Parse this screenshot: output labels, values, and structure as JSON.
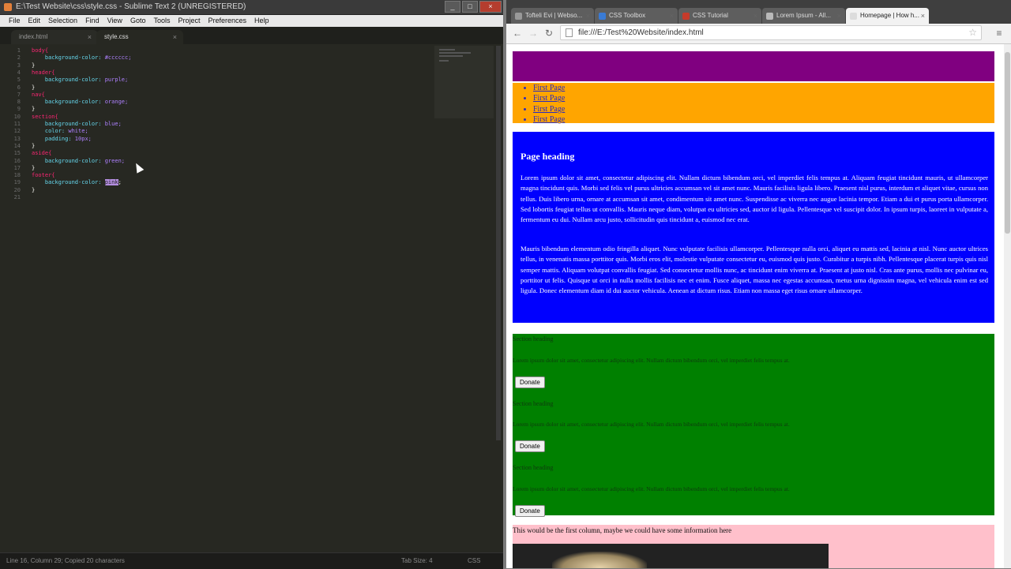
{
  "sublime": {
    "title": "E:\\Test Website\\css\\style.css - Sublime Text 2 (UNREGISTERED)",
    "menu": [
      "File",
      "Edit",
      "Selection",
      "Find",
      "View",
      "Goto",
      "Tools",
      "Project",
      "Preferences",
      "Help"
    ],
    "tabs": [
      {
        "label": "index.html",
        "close": "×"
      },
      {
        "label": "style.css",
        "close": "×"
      }
    ],
    "line_numbers": [
      "1",
      "2",
      "3",
      "4",
      "5",
      "6",
      "7",
      "8",
      "9",
      "10",
      "11",
      "12",
      "13",
      "14",
      "15",
      "16",
      "17",
      "18",
      "19",
      "20",
      "21"
    ],
    "code": [
      {
        "sel": "body{"
      },
      {
        "prop": "    background-color: ",
        "val": "#cccccc;"
      },
      {
        "pun": "}"
      },
      {
        "sel": "header{"
      },
      {
        "prop": "    background-color: ",
        "val": "purple;"
      },
      {
        "pun": "}"
      },
      {
        "sel": "nav{"
      },
      {
        "prop": "    background-color: ",
        "val": "orange;"
      },
      {
        "pun": "}"
      },
      {
        "sel": "section{"
      },
      {
        "prop": "    background-color: ",
        "val": "blue;"
      },
      {
        "prop": "    color: ",
        "val": "white;"
      },
      {
        "prop": "    padding: ",
        "val": "10px;"
      },
      {
        "pun": "}"
      },
      {
        "sel": "aside{"
      },
      {
        "prop": "    background-color: ",
        "val": "green;"
      },
      {
        "pun": "}"
      },
      {
        "sel": "footer{"
      },
      {
        "prop": "    background-color: ",
        "val": "pink",
        "hl": true,
        "tail": ";"
      },
      {
        "pun": "}"
      }
    ],
    "status": {
      "left": "Line 16, Column 29; Copied 20 characters",
      "middle": "Tab Size: 4",
      "right": "CSS"
    },
    "window_buttons": [
      "_",
      "□",
      "×"
    ]
  },
  "chrome": {
    "tabs": [
      {
        "label": "Tofteli Evi | Webso...",
        "close": "×"
      },
      {
        "label": "CSS Toolbox",
        "close": "×"
      },
      {
        "label": "CSS Tutorial",
        "close": "×"
      },
      {
        "label": "Lorem Ipsum - All...",
        "close": "×"
      },
      {
        "label": "Homepage | How h...",
        "close": "×"
      }
    ],
    "url": "file:///E:/Test%20Website/index.html",
    "nav": {
      "back": "←",
      "forward": "→",
      "reload": "↻",
      "star": "☆",
      "menu": "≡"
    }
  },
  "webpage": {
    "header_title": "",
    "nav_items": [
      "First Page",
      "First Page",
      "First Page",
      "First Page"
    ],
    "main": {
      "heading": "Page heading",
      "para1": "Lorem ipsum dolor sit amet, consectetur adipiscing elit. Nullam dictum bibendum orci, vel imperdiet felis tempus at. Aliquam feugiat tincidunt mauris, ut ullamcorper magna tincidunt quis. Morbi sed felis vel purus ultricies accumsan vel sit amet nunc. Mauris facilisis ligula libero. Praesent nisl purus, interdum et aliquet vitae, cursus non tellus. Duis libero urna, ornare at accumsan sit amet, condimentum sit amet nunc. Suspendisse ac viverra nec augue lacinia tempor. Etiam a dui et purus porta ullamcorper. Sed lobortis feugiat tellus ut convallis. Mauris neque diam, volutpat eu ultricies sed, auctor id ligula. Pellentesque vel suscipit dolor. In ipsum turpis, laoreet in vulputate a, fermentum eu dui. Nullam arcu justo, sollicitudin quis tincidunt a, euismod nec erat.",
      "para2": "Mauris bibendum elementum odio fringilla aliquet. Nunc vulputate facilisis ullamcorper. Pellentesque nulla orci, aliquet eu mattis sed, lacinia at nisl. Nunc auctor ultrices tellus, in venenatis massa porttitor quis. Morbi eros elit, molestie vulputate consectetur eu, euismod quis justo. Curabitur a turpis nibh. Pellentesque placerat turpis quis nisl semper mattis. Aliquam volutpat convallis feugiat. Sed consectetur mollis nunc, ac tincidunt enim viverra at. Praesent at justo nisl. Cras ante purus, mollis nec pulvinar eu, porttitor ut felis. Quisque ut orci in nulla mollis facilisis nec et enim. Fusce aliquet, massa nec egestas accumsan, metus urna dignissim magna, vel vehicula enim est sed ligula. Donec elementum diam id dui auctor vehicula. Aenean at dictum risus. Etiam non massa eget risus ornare ullamcorper."
    },
    "aside": [
      {
        "heading": "Section heading",
        "text": "Lorem ipsum dolor sit amet, consectetur adipiscing elit. Nullam dictum bibendum orci, vel imperdiet felis tempus at.",
        "button": "Donate"
      },
      {
        "heading": "Section heading",
        "text": "Lorem ipsum dolor sit amet, consectetur adipiscing elit. Nullam dictum bibendum orci, vel imperdiet felis tempus at.",
        "button": "Donate"
      },
      {
        "heading": "Section heading",
        "text": "Lorem ipsum dolor sit amet, consectetur adipiscing elit. Nullam dictum bibendum orci, vel imperdiet felis tempus at.",
        "button": "Donate"
      }
    ],
    "footer_text": "This would be the first column, maybe we could have some information here"
  },
  "colors": {
    "header": "#800080",
    "nav": "#ffa500",
    "main": "#0000ff",
    "aside": "#008000",
    "footer": "#ffc0cb",
    "editor_bg": "#272822"
  }
}
